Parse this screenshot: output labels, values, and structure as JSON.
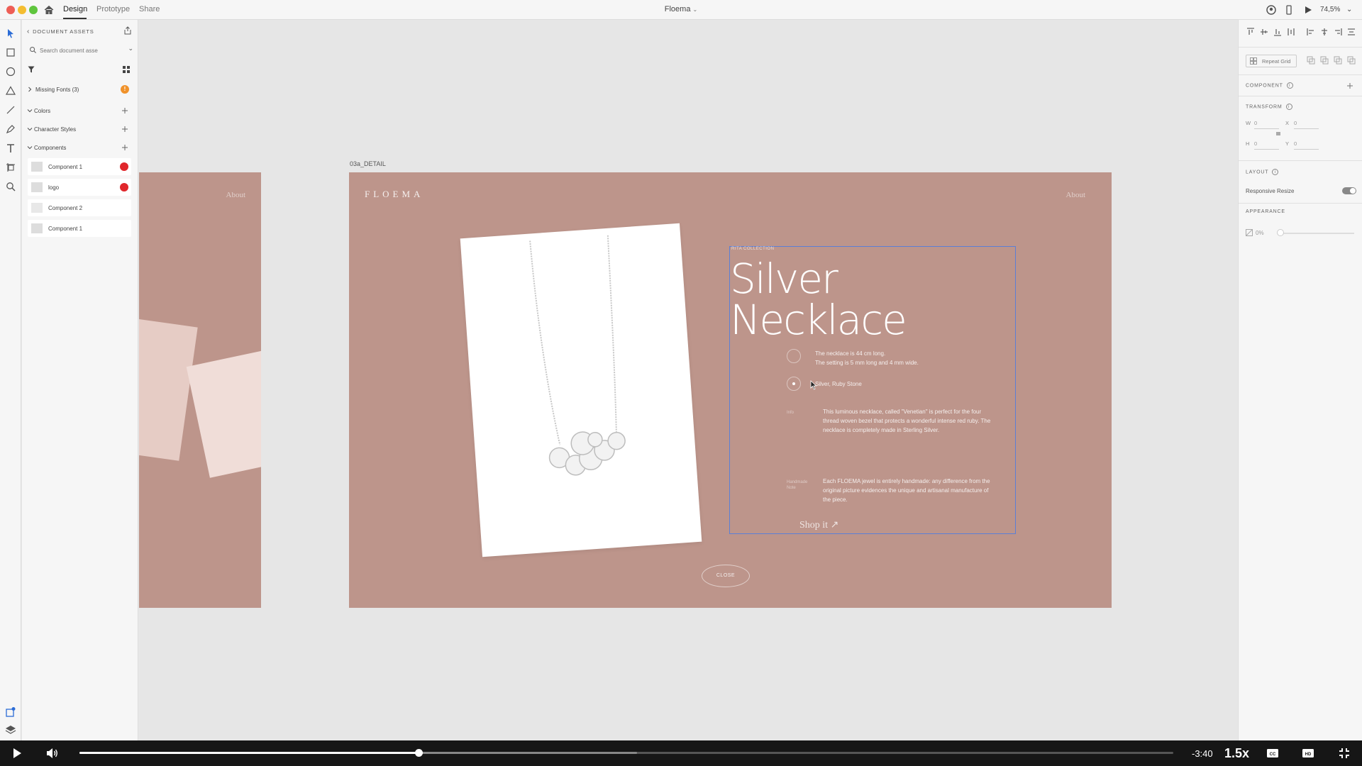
{
  "window": {
    "document_title": "Floema",
    "tabs": [
      {
        "label": "Design"
      },
      {
        "label": "Prototype"
      },
      {
        "label": "Share"
      }
    ],
    "zoom": "74,5%"
  },
  "assets_panel": {
    "title": "DOCUMENT ASSETS",
    "search_placeholder": "Search document asse",
    "missing_fonts": "Missing Fonts (3)",
    "missing_badge": "!",
    "sections": {
      "colors": "Colors",
      "character_styles": "Character Styles",
      "components": "Components"
    },
    "components": [
      {
        "name": "Component 1"
      },
      {
        "name": "logo"
      },
      {
        "name": "Component 2"
      },
      {
        "name": "Component 1"
      }
    ]
  },
  "canvas": {
    "left_artboard_about": "About",
    "artboard_label": "03a_DETAIL",
    "brand": "FLOEMA",
    "about": "About",
    "collection_label": "RITA COLLECTION",
    "product_title_line1": "Silver",
    "product_title_line2": "Necklace",
    "details": {
      "size_line1": "The necklace is 44 cm long.",
      "size_line2": "The setting is 5 mm long and 4 mm wide.",
      "material": "Silver, Ruby Stone",
      "info_label": "Info",
      "info_text": "This luminous necklace, called \"Venetian\" is perfect for the four thread woven bezel that protects a wonderful intense red ruby. The necklace is completely made in Sterling Silver.",
      "handmade_label": "Handmade Note",
      "handmade_text": "Each FLOEMA jewel is entirely handmade: any difference from the original picture evidences the unique and artisanal manufacture of the piece."
    },
    "shop_label": "Shop it ↗",
    "close_label": "CLOSE"
  },
  "inspector": {
    "repeat_grid": "Repeat Grid",
    "component_heading": "COMPONENT",
    "transform_heading": "TRANSFORM",
    "w_label": "W",
    "w_value": "0",
    "x_label": "X",
    "x_value": "0",
    "h_label": "H",
    "h_value": "0",
    "y_label": "Y",
    "y_value": "0",
    "layout_heading": "LAYOUT",
    "responsive_resize": "Responsive Resize",
    "appearance_heading": "APPEARANCE",
    "opacity_value": "0%"
  },
  "video": {
    "time_remaining": "-3:40",
    "speed": "1.5x",
    "progress": 0.31,
    "buffered": 0.51
  }
}
